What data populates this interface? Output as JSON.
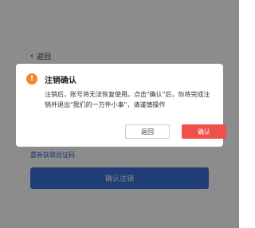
{
  "page": {
    "back_label": "返回",
    "resend_label": "重新获取验证码",
    "confirm_button_label": "确认注销"
  },
  "dialog": {
    "icon": "warning-icon",
    "icon_glyph": "!",
    "title": "注销确认",
    "body": "注销后，账号将无法恢复使用。点击\"确认\"后，你将完成注销并退出\"我们的一万件小事\"，请谨慎操作",
    "cancel_label": "返回",
    "ok_label": "确认"
  },
  "colors": {
    "accent_blue": "#3a6fd8",
    "danger_red": "#f1504a",
    "warning_orange": "#f08a24"
  }
}
